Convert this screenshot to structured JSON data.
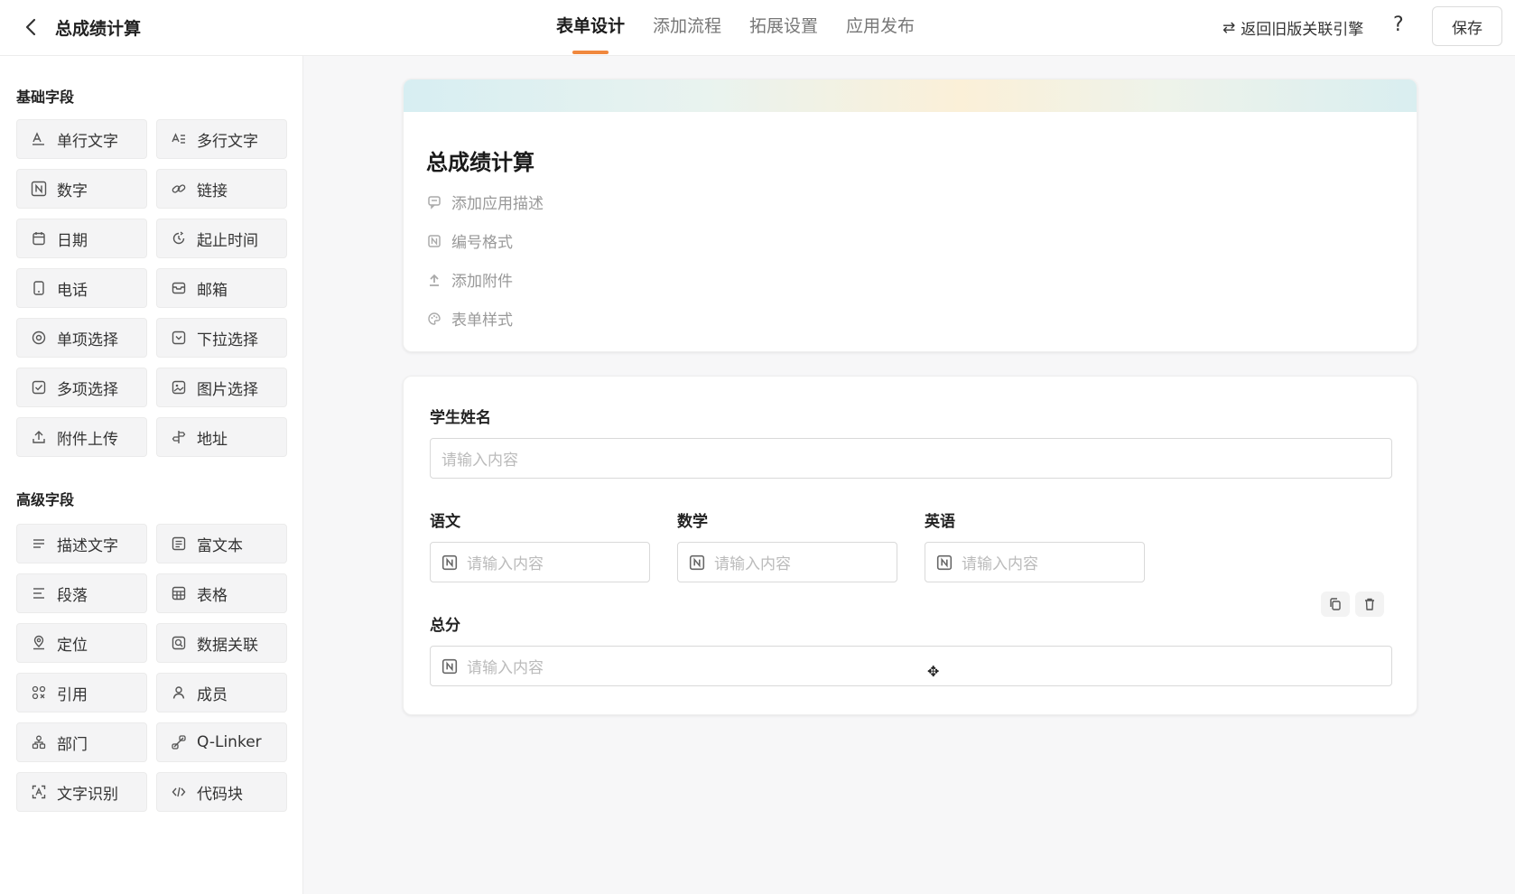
{
  "header": {
    "title": "总成绩计算",
    "tabs": [
      {
        "label": "表单设计",
        "active": true
      },
      {
        "label": "添加流程",
        "active": false
      },
      {
        "label": "拓展设置",
        "active": false
      },
      {
        "label": "应用发布",
        "active": false
      }
    ],
    "legacy_link": "返回旧版关联引擎",
    "help_label": "?",
    "save_label": "保存",
    "accent_color": "#f0883e"
  },
  "sidebar": {
    "basic_title": "基础字段",
    "basic_fields": [
      {
        "label": "单行文字",
        "icon": "single-line-text-icon"
      },
      {
        "label": "多行文字",
        "icon": "multi-line-text-icon"
      },
      {
        "label": "数字",
        "icon": "number-icon"
      },
      {
        "label": "链接",
        "icon": "link-icon"
      },
      {
        "label": "日期",
        "icon": "calendar-icon"
      },
      {
        "label": "起止时间",
        "icon": "time-range-icon"
      },
      {
        "label": "电话",
        "icon": "phone-icon"
      },
      {
        "label": "邮箱",
        "icon": "mail-icon"
      },
      {
        "label": "单项选择",
        "icon": "radio-icon"
      },
      {
        "label": "下拉选择",
        "icon": "dropdown-icon"
      },
      {
        "label": "多项选择",
        "icon": "checkbox-icon"
      },
      {
        "label": "图片选择",
        "icon": "image-icon"
      },
      {
        "label": "附件上传",
        "icon": "upload-icon"
      },
      {
        "label": "地址",
        "icon": "address-icon"
      }
    ],
    "advanced_title": "高级字段",
    "advanced_fields": [
      {
        "label": "描述文字",
        "icon": "description-icon"
      },
      {
        "label": "富文本",
        "icon": "rich-text-icon"
      },
      {
        "label": "段落",
        "icon": "paragraph-icon"
      },
      {
        "label": "表格",
        "icon": "table-icon"
      },
      {
        "label": "定位",
        "icon": "location-icon"
      },
      {
        "label": "数据关联",
        "icon": "data-link-icon"
      },
      {
        "label": "引用",
        "icon": "reference-icon"
      },
      {
        "label": "成员",
        "icon": "member-icon"
      },
      {
        "label": "部门",
        "icon": "department-icon"
      },
      {
        "label": "Q-Linker",
        "icon": "q-linker-icon"
      },
      {
        "label": "文字识别",
        "icon": "ocr-icon"
      },
      {
        "label": "代码块",
        "icon": "code-icon"
      }
    ]
  },
  "form": {
    "title": "总成绩计算",
    "options": [
      {
        "label": "添加应用描述",
        "icon": "comment-icon"
      },
      {
        "label": "编号格式",
        "icon": "number-format-icon"
      },
      {
        "label": "添加附件",
        "icon": "upload-icon"
      },
      {
        "label": "表单样式",
        "icon": "palette-icon"
      }
    ],
    "fields": {
      "student_name": {
        "label": "学生姓名",
        "placeholder": "请输入内容"
      },
      "chinese": {
        "label": "语文",
        "placeholder": "请输入内容"
      },
      "math": {
        "label": "数学",
        "placeholder": "请输入内容"
      },
      "english": {
        "label": "英语",
        "placeholder": "请输入内容"
      },
      "total": {
        "label": "总分",
        "placeholder": "请输入内容"
      }
    }
  }
}
